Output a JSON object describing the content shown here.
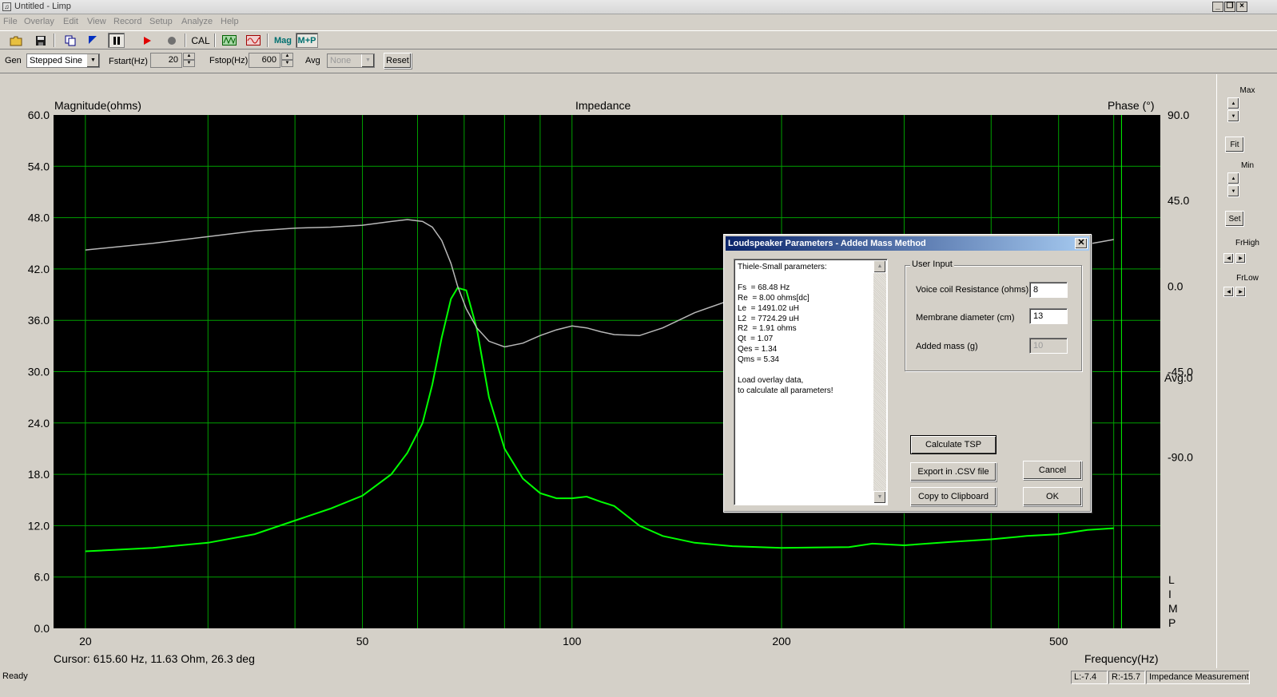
{
  "window": {
    "title": "Untitled - Limp",
    "icon": "app-icon",
    "controls": [
      "minimize-icon",
      "restore-icon",
      "close-icon"
    ]
  },
  "menu": [
    "File",
    "Overlay",
    "Edit",
    "View",
    "Record",
    "Setup",
    "Analyze",
    "Help"
  ],
  "toolbar": {
    "cal_label": "CAL",
    "mag_label": "Mag",
    "mp_label": "M+P",
    "icons": [
      "open-folder-icon",
      "save-icon",
      "copy-icon",
      "flag-icon",
      "pause-icon",
      "play-icon",
      "record-icon",
      "gen-icon",
      "wave-icon"
    ]
  },
  "controls": {
    "gen_label": "Gen",
    "gen_value": "Stepped Sine",
    "fstart_label": "Fstart(Hz)",
    "fstart_value": "20",
    "fstop_label": "Fstop(Hz)",
    "fstop_value": "600",
    "avg_label": "Avg",
    "avg_value": "None",
    "reset_label": "Reset"
  },
  "chart_data": {
    "type": "line",
    "title": "Impedance",
    "ylabel": "Magnitude(ohms)",
    "y2label": "Phase (°)",
    "xlabel": "Frequency(Hz)",
    "xscale": "log",
    "xlim": [
      18,
      700
    ],
    "ylim": [
      0,
      60
    ],
    "y2lim": [
      -180,
      90
    ],
    "x_ticks": [
      "20",
      "50",
      "100",
      "200",
      "500"
    ],
    "y_ticks": [
      "60.0",
      "54.0",
      "48.0",
      "42.0",
      "36.0",
      "30.0",
      "24.0",
      "18.0",
      "12.0",
      "6.0",
      "0.0"
    ],
    "y2_ticks": [
      "90.0",
      "45.0",
      "0.0",
      "-45.0",
      "-90.0"
    ],
    "avg_text": "Avg:0",
    "side_text": "LIMP",
    "grid": true,
    "series": [
      {
        "role": "magnitude",
        "color": "#00ff00",
        "axis": "left",
        "x": [
          20,
          25,
          30,
          35,
          40,
          45,
          50,
          55,
          58,
          61,
          63,
          65,
          67,
          68.5,
          70.5,
          73,
          76,
          80,
          85,
          90,
          95,
          100,
          105,
          110,
          115,
          125,
          135,
          150,
          170,
          200,
          250,
          270,
          300,
          350,
          400,
          450,
          500,
          550,
          600
        ],
        "values": [
          9.0,
          9.4,
          10.0,
          11.0,
          12.6,
          14.0,
          15.5,
          18.0,
          20.5,
          24.0,
          28.5,
          34.0,
          38.5,
          39.8,
          39.5,
          35.0,
          27.0,
          21.0,
          17.5,
          15.8,
          15.2,
          15.2,
          15.4,
          14.8,
          14.3,
          12.0,
          10.8,
          10.0,
          9.6,
          9.4,
          9.5,
          9.9,
          9.7,
          10.1,
          10.4,
          10.8,
          11.0,
          11.5,
          11.7
        ]
      },
      {
        "role": "phase",
        "color": "#b8b8b8",
        "axis": "right",
        "x": [
          20,
          25,
          30,
          35,
          40,
          45,
          50,
          55,
          58,
          61,
          63,
          65,
          67,
          68.5,
          70.5,
          73,
          76,
          80,
          85,
          90,
          95,
          100,
          105,
          110,
          115,
          125,
          135,
          150,
          170,
          200,
          250,
          270,
          300,
          350,
          400,
          450,
          500,
          550,
          600
        ],
        "values": [
          19.0,
          22.5,
          26.0,
          29.0,
          30.5,
          31.0,
          32.0,
          34.0,
          35.0,
          34.0,
          31.0,
          24.0,
          12.0,
          0.0,
          -12.0,
          -22.0,
          -29.0,
          -32.0,
          -30.0,
          -26.0,
          -23.0,
          -21.0,
          -22.0,
          -24.0,
          -25.5,
          -26.0,
          -22.0,
          -14.0,
          -7.0,
          -2.0,
          4.5,
          7.5,
          7.0,
          11.5,
          14.0,
          16.5,
          19.0,
          22.0,
          24.5
        ]
      }
    ]
  },
  "cursor_text": "Cursor: 615.60 Hz, 11.63 Ohm, 26.3 deg",
  "right_panel": {
    "max_label": "Max",
    "fit_label": "Fit",
    "min_label": "Min",
    "set_label": "Set",
    "frhigh_label": "FrHigh",
    "frlow_label": "FrLow"
  },
  "status": {
    "ready": "Ready",
    "left": "L:-7.4",
    "right": "R:-15.7",
    "mode": "Impedance Measurement"
  },
  "dialog": {
    "title": "Loudspeaker Parameters - Added Mass Method",
    "tsp_text": "Thiele-Small parameters:\n\nFs  = 68.48 Hz\nRe  = 8.00 ohms[dc]\nLe  = 1491.02 uH\nL2  = 7724.29 uH\nR2  = 1.91 ohms\nQt  = 1.07\nQes = 1.34\nQms = 5.34\n\nLoad overlay data,\nto calculate all parameters!",
    "group_title": "User Input",
    "voice_coil_label": "Voice coil Resistance (ohms)",
    "voice_coil_value": "8",
    "membrane_label": "Membrane diameter (cm)",
    "membrane_value": "13",
    "added_mass_label": "Added mass (g)",
    "added_mass_value": "10",
    "calc_button": "Calculate TSP",
    "export_button": "Export in .CSV file",
    "copy_button": "Copy to Clipboard",
    "cancel_button": "Cancel",
    "ok_button": "OK"
  }
}
